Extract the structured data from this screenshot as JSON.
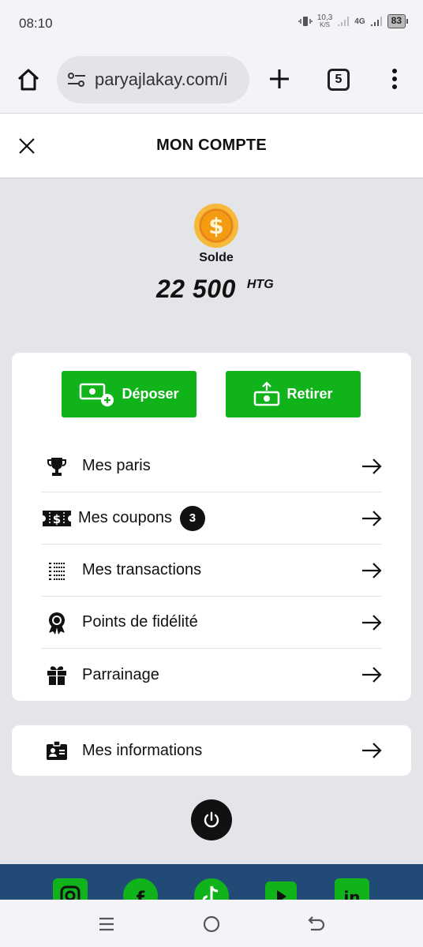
{
  "status_bar": {
    "time": "08:10",
    "speed_value": "10,3",
    "speed_unit": "K/S",
    "network": "4G",
    "battery": "83"
  },
  "browser": {
    "url": "paryajlakay.com/i",
    "tab_count": "5"
  },
  "header": {
    "title": "MON COMPTE"
  },
  "balance": {
    "label": "Solde",
    "amount": "22 500",
    "currency": "HTG"
  },
  "actions": {
    "deposit_label": "Déposer",
    "withdraw_label": "Retirer"
  },
  "menu": {
    "items": [
      {
        "label": "Mes paris",
        "icon": "trophy-icon"
      },
      {
        "label": "Mes coupons",
        "icon": "ticket-icon",
        "badge": "3"
      },
      {
        "label": "Mes transactions",
        "icon": "list-icon"
      },
      {
        "label": "Points de fidélité",
        "icon": "award-icon"
      },
      {
        "label": "Parrainage",
        "icon": "gift-icon"
      }
    ]
  },
  "info": {
    "label": "Mes informations",
    "icon": "id-card-icon"
  },
  "social": [
    "instagram-icon",
    "facebook-icon",
    "tiktok-icon",
    "youtube-icon",
    "linkedin-icon"
  ],
  "colors": {
    "accent": "#11b31a",
    "footer": "#214b76",
    "background": "#e4e5e9"
  }
}
